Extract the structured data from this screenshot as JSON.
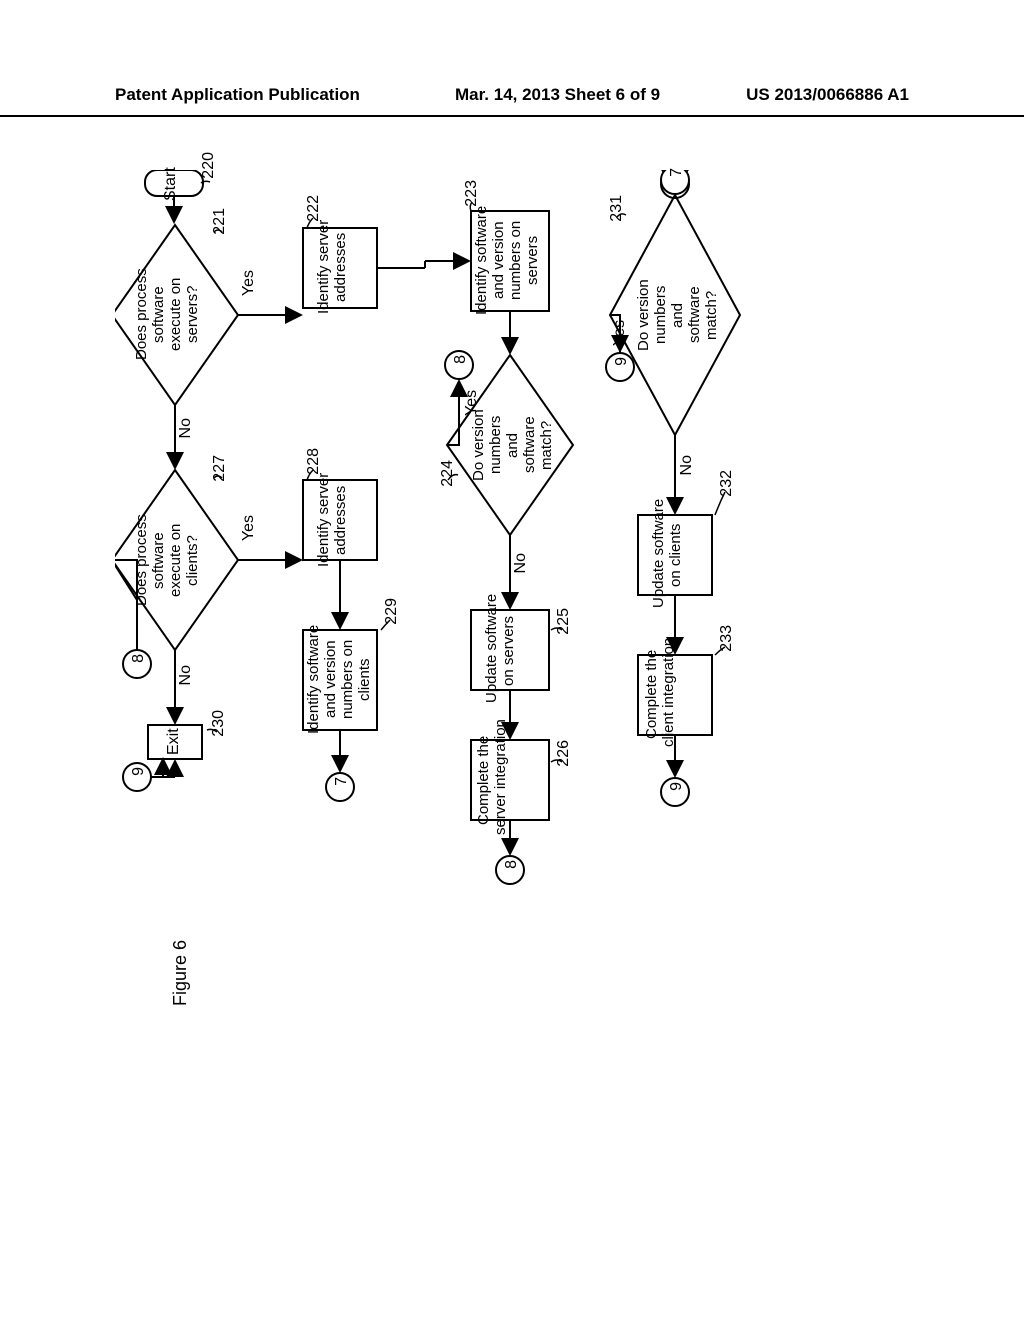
{
  "header": {
    "left": "Patent Application Publication",
    "mid": "Mar. 14, 2013  Sheet 6 of 9",
    "right": "US 2013/0066886 A1"
  },
  "refs": {
    "start": "220",
    "d221": "221",
    "b222": "222",
    "b223": "223",
    "d224": "224",
    "b225": "225",
    "b226": "226",
    "d227": "227",
    "b228": "228",
    "b229": "229",
    "b230": "230",
    "d231": "231",
    "b232": "232",
    "b233": "233"
  },
  "labels": {
    "start": "Start",
    "exit": "Exit",
    "yes": "Yes",
    "no": "No",
    "d221": "Does process\nsoftware\nexecute on\nservers?",
    "b222": "Identify server\naddresses",
    "b223": "Identify software\nand version\nnumbers on\nservers",
    "d224": "Do version\nnumbers\nand\nsoftware\nmatch?",
    "b225": "Update software\non servers",
    "b226": "Complete the\nserver integration",
    "d227": "Does process\nsoftware\nexecute on\nclients?",
    "b228": "Identify server\naddresses",
    "b229": "Identify software\nand version\nnumbers on\nclients",
    "d231": "Do version\nnumbers\nand\nsoftware\nmatch?",
    "b232": "Update software\non clients",
    "b233": "Complete the\nclient integration",
    "c7": "7",
    "c8": "8",
    "c9": "9",
    "figcap": "Figure 6"
  },
  "chart_data": {
    "type": "flowchart",
    "nodes": [
      {
        "id": "220",
        "shape": "terminator",
        "label": "Start"
      },
      {
        "id": "221",
        "shape": "decision",
        "label": "Does process software execute on servers?"
      },
      {
        "id": "222",
        "shape": "process",
        "label": "Identify server addresses"
      },
      {
        "id": "223",
        "shape": "process",
        "label": "Identify software and version numbers on servers"
      },
      {
        "id": "224",
        "shape": "decision",
        "label": "Do version numbers and software match?"
      },
      {
        "id": "225",
        "shape": "process",
        "label": "Update software on servers"
      },
      {
        "id": "226",
        "shape": "process",
        "label": "Complete the server integration"
      },
      {
        "id": "227",
        "shape": "decision",
        "label": "Does process software execute on clients?"
      },
      {
        "id": "228",
        "shape": "process",
        "label": "Identify server addresses"
      },
      {
        "id": "229",
        "shape": "process",
        "label": "Identify software and version numbers on clients"
      },
      {
        "id": "230",
        "shape": "process",
        "label": "Exit"
      },
      {
        "id": "231",
        "shape": "decision",
        "label": "Do version numbers and software match?"
      },
      {
        "id": "232",
        "shape": "process",
        "label": "Update software on clients"
      },
      {
        "id": "233",
        "shape": "process",
        "label": "Complete the client integration"
      },
      {
        "id": "c7_top",
        "shape": "connector",
        "label": "7"
      },
      {
        "id": "c7_bottom",
        "shape": "connector",
        "label": "7"
      },
      {
        "id": "c8_left",
        "shape": "connector",
        "label": "8"
      },
      {
        "id": "c8_mid",
        "shape": "connector",
        "label": "8"
      },
      {
        "id": "c8_right",
        "shape": "connector",
        "label": "8"
      },
      {
        "id": "c9_left",
        "shape": "connector",
        "label": "9"
      },
      {
        "id": "c9_mid",
        "shape": "connector",
        "label": "9"
      },
      {
        "id": "c9_right",
        "shape": "connector",
        "label": "9"
      }
    ],
    "edges": [
      {
        "from": "220",
        "to": "221"
      },
      {
        "from": "221",
        "to": "222",
        "label": "Yes"
      },
      {
        "from": "221",
        "to": "227",
        "label": "No"
      },
      {
        "from": "222",
        "to": "223"
      },
      {
        "from": "223",
        "to": "224"
      },
      {
        "from": "224",
        "to": "c8_mid",
        "label": "Yes"
      },
      {
        "from": "224",
        "to": "225",
        "label": "No"
      },
      {
        "from": "225",
        "to": "226"
      },
      {
        "from": "226",
        "to": "c8_right"
      },
      {
        "from": "c8_left",
        "to": "227"
      },
      {
        "from": "227",
        "to": "228",
        "label": "Yes"
      },
      {
        "from": "227",
        "to": "230",
        "label": "No"
      },
      {
        "from": "228",
        "to": "229"
      },
      {
        "from": "229",
        "to": "c7_bottom"
      },
      {
        "from": "c7_top",
        "to": "231"
      },
      {
        "from": "231",
        "to": "c9_mid",
        "label": "Yes"
      },
      {
        "from": "231",
        "to": "232",
        "label": "No"
      },
      {
        "from": "232",
        "to": "233"
      },
      {
        "from": "233",
        "to": "c9_right"
      },
      {
        "from": "c9_left",
        "to": "230"
      }
    ]
  }
}
